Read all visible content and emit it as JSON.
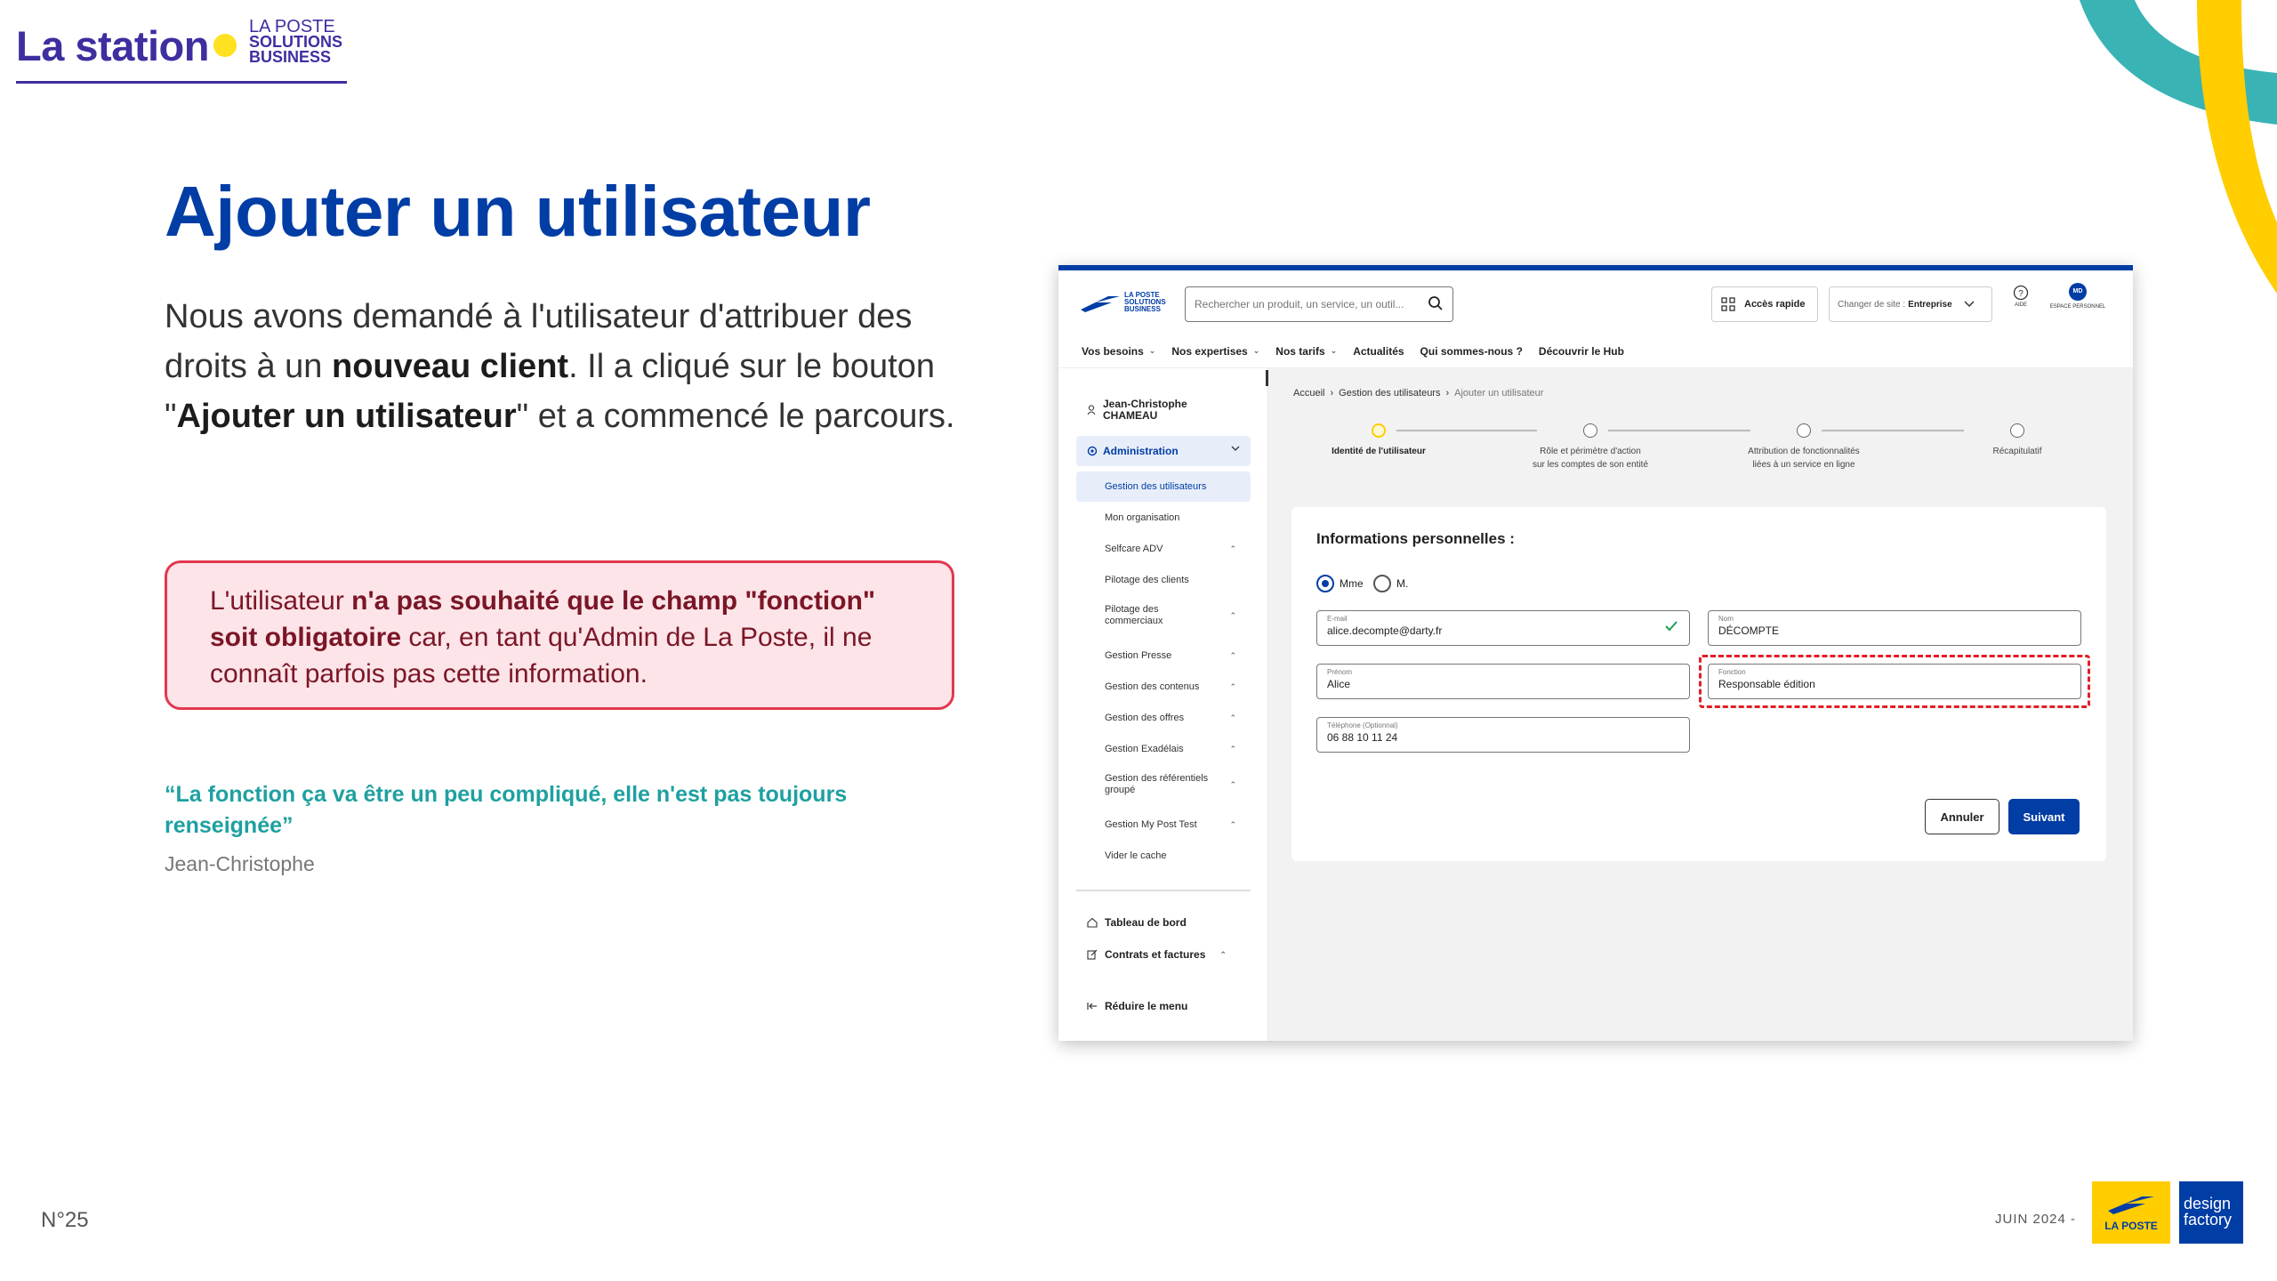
{
  "slide": {
    "brand_name": "La station",
    "brand_sub": [
      "LA POSTE",
      "SOLUTIONS",
      "BUSINESS"
    ],
    "title": "Ajouter un utilisateur",
    "intro": {
      "p1": "Nous avons demandé à l'utilisateur d'attribuer des droits à un ",
      "b1": "nouveau client",
      "p2": ". Il a cliqué sur le bouton \"",
      "b2": "Ajouter un utilisateur",
      "p3": "\" et a commencé le parcours."
    },
    "callout": {
      "p1": "L'utilisateur ",
      "b1": "n'a pas souhaité que le champ \"fonction\" soit obligatoire",
      "p2": " car, en tant qu'Admin de La Poste, il ne connaît parfois pas cette information."
    },
    "quote": "“La fonction ça va être un peu compliqué, elle n'est pas toujours renseignée”",
    "quote_author": "Jean-Christophe",
    "page_number": "N°25",
    "date": "JUIN 2024 -",
    "logo_laposte": "LA POSTE",
    "logo_design_factory": [
      "design",
      "factory"
    ],
    "colors": {
      "primary": "#003da5",
      "purple": "#3d2fa0",
      "yellow": "#ffcd00",
      "teal": "#1ea0a0",
      "alert": "#e2384f"
    }
  },
  "app": {
    "logo_text": [
      "LA POSTE",
      "SOLUTIONS",
      "BUSINESS"
    ],
    "search_placeholder": "Rechercher un produit, un service, un outil...",
    "quick_access": "Accès rapide",
    "site_switch_label": "Changer de site :",
    "site_switch_value": "Entreprise",
    "aide": "AIDE",
    "espace": "ESPACE PERSONNEL",
    "avatar_initials": "MD",
    "nav": [
      "Vos besoins",
      "Nos expertises",
      "Nos tarifs",
      "Actualités",
      "Qui sommes-nous ?",
      "Découvrir le Hub"
    ],
    "user_name": [
      "Jean-Christophe",
      "CHAMEAU"
    ],
    "sidebar_section": "Administration",
    "sidebar_items": [
      "Gestion des utilisateurs",
      "Mon organisation",
      "Selfcare ADV",
      "Pilotage des clients",
      [
        "Pilotage des",
        "commerciaux"
      ],
      "Gestion Presse",
      "Gestion des contenus",
      "Gestion des offres",
      "Gestion Exadélais",
      [
        "Gestion des référentiels",
        "groupé"
      ],
      "Gestion My Post Test",
      "Vider le cache"
    ],
    "sidebar_main": [
      "Tableau de bord",
      "Contrats et factures",
      "Réduire le menu"
    ],
    "breadcrumb": [
      "Accueil",
      "Gestion des utilisateurs",
      "Ajouter un utilisateur"
    ],
    "steps": [
      [
        "Identité de l'utilisateur"
      ],
      [
        "Rôle et périmètre d'action",
        "sur les comptes de son entité"
      ],
      [
        "Attribution de fonctionnalités",
        "liées à un service en ligne"
      ],
      [
        "Récapitulatif"
      ]
    ],
    "form_title": "Informations personnelles :",
    "radio_options": [
      "Mme",
      "M."
    ],
    "radio_selected": "Mme",
    "fields": {
      "email": {
        "label": "E-mail",
        "value": "alice.decompte@darty.fr"
      },
      "nom": {
        "label": "Nom",
        "value": "DÉCOMPTE"
      },
      "prenom": {
        "label": "Prénom",
        "value": "Alice"
      },
      "fonction": {
        "label": "Fonction",
        "value": "Responsable édition"
      },
      "telephone": {
        "label": "Téléphone (Optionnal)",
        "value": "06 88 10 11 24"
      }
    },
    "btn_cancel": "Annuler",
    "btn_next": "Suivant"
  }
}
